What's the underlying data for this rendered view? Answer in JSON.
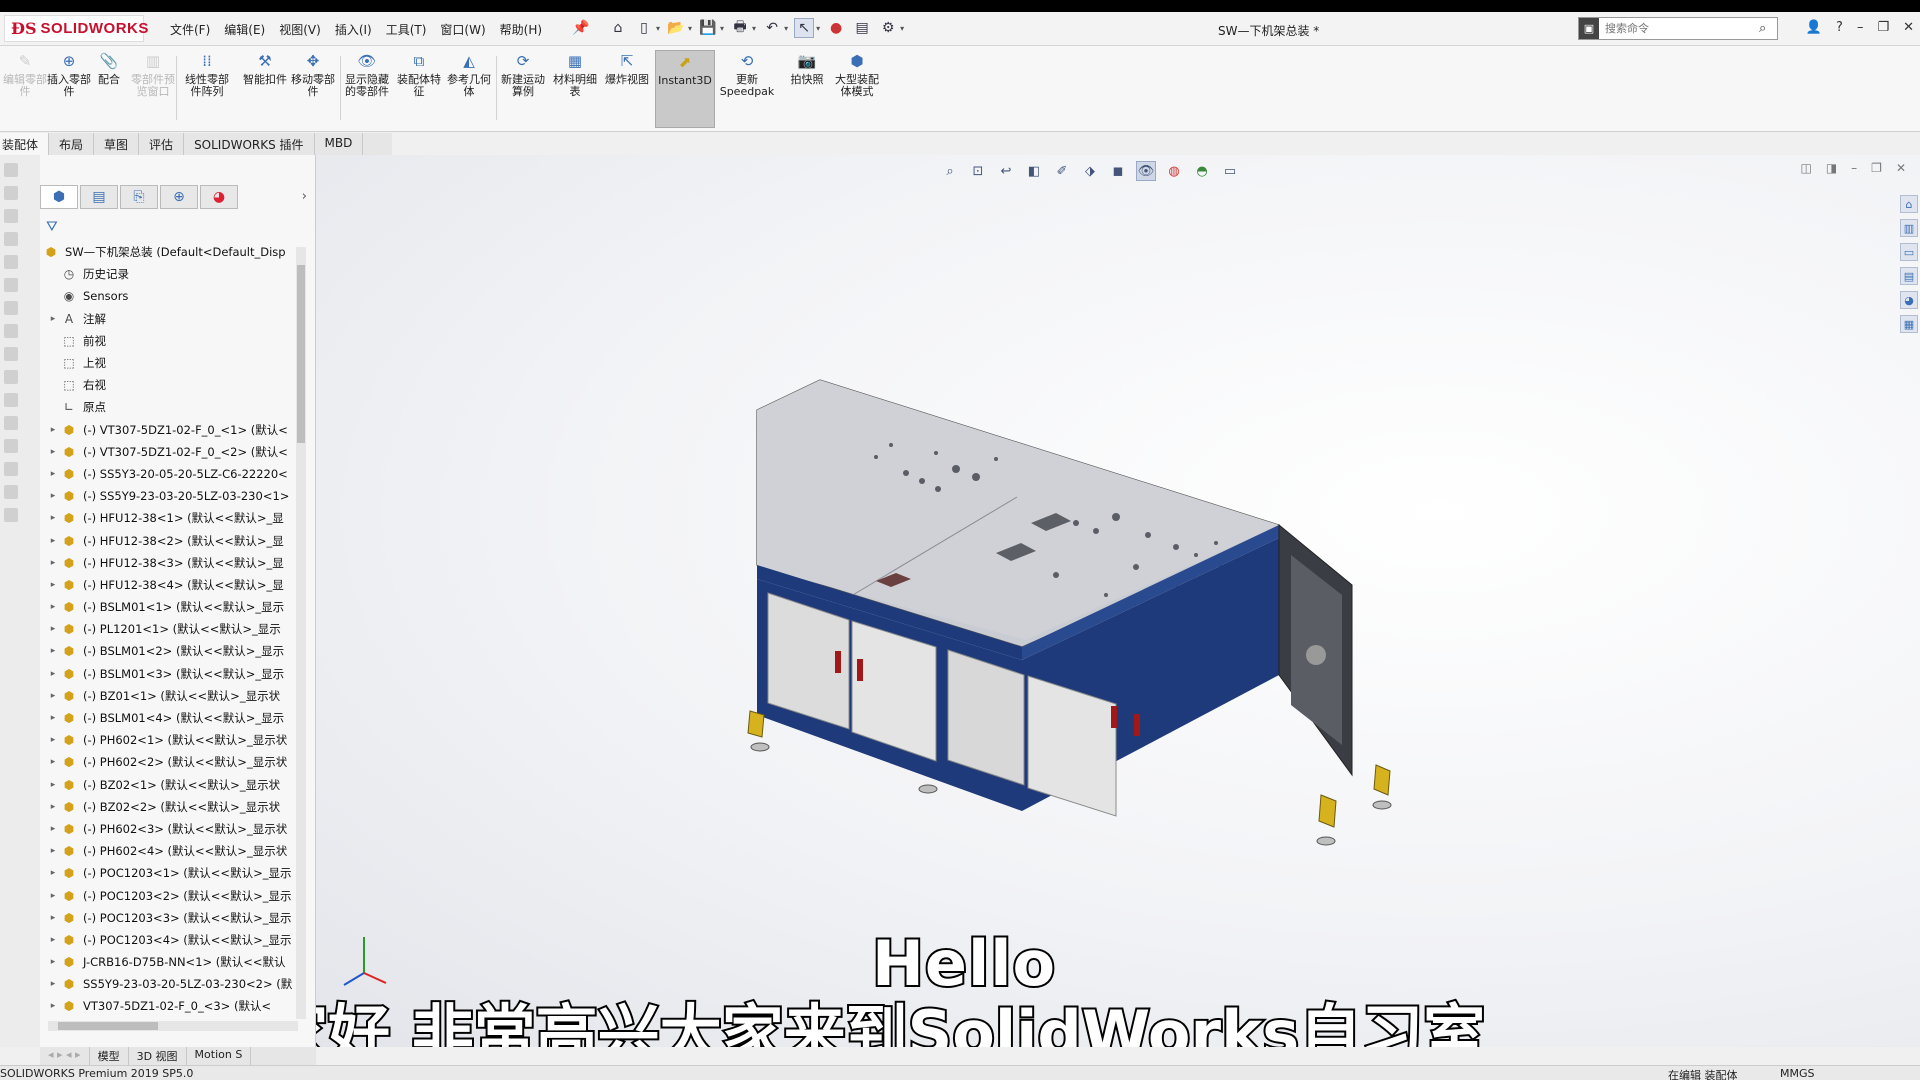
{
  "app": {
    "logo_text": "SOLIDWORKS",
    "document_title": "SW—下机架总装 *"
  },
  "menu": [
    "文件(F)",
    "编辑(E)",
    "视图(V)",
    "插入(I)",
    "工具(T)",
    "窗口(W)",
    "帮助(H)"
  ],
  "search": {
    "placeholder": "搜索命令"
  },
  "commands": [
    {
      "label": "编辑零部件",
      "enabled": false
    },
    {
      "label": "插入零部件",
      "enabled": true
    },
    {
      "label": "配合",
      "enabled": true
    },
    {
      "label": "零部件预览窗口",
      "enabled": false
    },
    {
      "label": "线性零部件阵列",
      "enabled": true
    },
    {
      "label": "智能扣件",
      "enabled": true
    },
    {
      "label": "移动零部件",
      "enabled": true
    },
    {
      "label": "显示隐藏的零部件",
      "enabled": true
    },
    {
      "label": "装配体特征",
      "enabled": true
    },
    {
      "label": "参考几何体",
      "enabled": true
    },
    {
      "label": "新建运动算例",
      "enabled": true
    },
    {
      "label": "材料明细表",
      "enabled": true
    },
    {
      "label": "爆炸视图",
      "enabled": true
    },
    {
      "label": "Instant3D",
      "enabled": true,
      "active": true
    },
    {
      "label": "更新Speedpak",
      "enabled": true
    },
    {
      "label": "拍快照",
      "enabled": true
    },
    {
      "label": "大型装配体模式",
      "enabled": true
    }
  ],
  "tabs": [
    "装配体",
    "布局",
    "草图",
    "评估",
    "SOLIDWORKS 插件",
    "MBD"
  ],
  "tree": {
    "root": "SW—下机架总装  (Default<Default_Disp",
    "features": [
      "历史记录",
      "Sensors",
      "注解",
      "前视",
      "上视",
      "右视",
      "原点"
    ],
    "components": [
      "(-) VT307-5DZ1-02-F_0_<1> (默认<",
      "(-) VT307-5DZ1-02-F_0_<2> (默认<",
      "(-) SS5Y3-20-05-20-5LZ-C6-22220<",
      "(-) SS5Y9-23-03-20-5LZ-03-230<1>",
      "(-) HFU12-38<1> (默认<<默认>_显",
      "(-) HFU12-38<2> (默认<<默认>_显",
      "(-) HFU12-38<3> (默认<<默认>_显",
      "(-) HFU12-38<4> (默认<<默认>_显",
      "(-) BSLM01<1> (默认<<默认>_显示",
      "(-) PL1201<1> (默认<<默认>_显示",
      "(-) BSLM01<2> (默认<<默认>_显示",
      "(-) BSLM01<3> (默认<<默认>_显示",
      "(-) BZ01<1> (默认<<默认>_显示状",
      "(-) BSLM01<4> (默认<<默认>_显示",
      "(-) PH602<1> (默认<<默认>_显示状",
      "(-) PH602<2> (默认<<默认>_显示状",
      "(-) BZ02<1> (默认<<默认>_显示状",
      "(-) BZ02<2> (默认<<默认>_显示状",
      "(-) PH602<3> (默认<<默认>_显示状",
      "(-) PH602<4> (默认<<默认>_显示状",
      "(-) POC1203<1> (默认<<默认>_显示",
      "(-) POC1203<2> (默认<<默认>_显示",
      "(-) POC1203<3> (默认<<默认>_显示",
      "(-) POC1203<4> (默认<<默认>_显示",
      "J-CRB16-D75B-NN<1> (默认<<默认",
      "SS5Y9-23-03-20-5LZ-03-230<2> (默",
      "VT307-5DZ1-02-F_0_<3> (默认<"
    ]
  },
  "bottom_tabs": [
    "模型",
    "3D 视图",
    "Motion S"
  ],
  "captions": {
    "line1": "Hello",
    "line2": "大家好   非常高兴大家来到SolidWorks自习室"
  },
  "status": {
    "left": "SOLIDWORKS Premium 2019 SP5.0",
    "mode": "在编辑 装配体",
    "units": "MMGS"
  },
  "colors": {
    "frame_blue": "#1f3a7a",
    "panel_grey": "#d7d7d7",
    "handle_red": "#a01818",
    "feet_yellow": "#d6b21e"
  }
}
